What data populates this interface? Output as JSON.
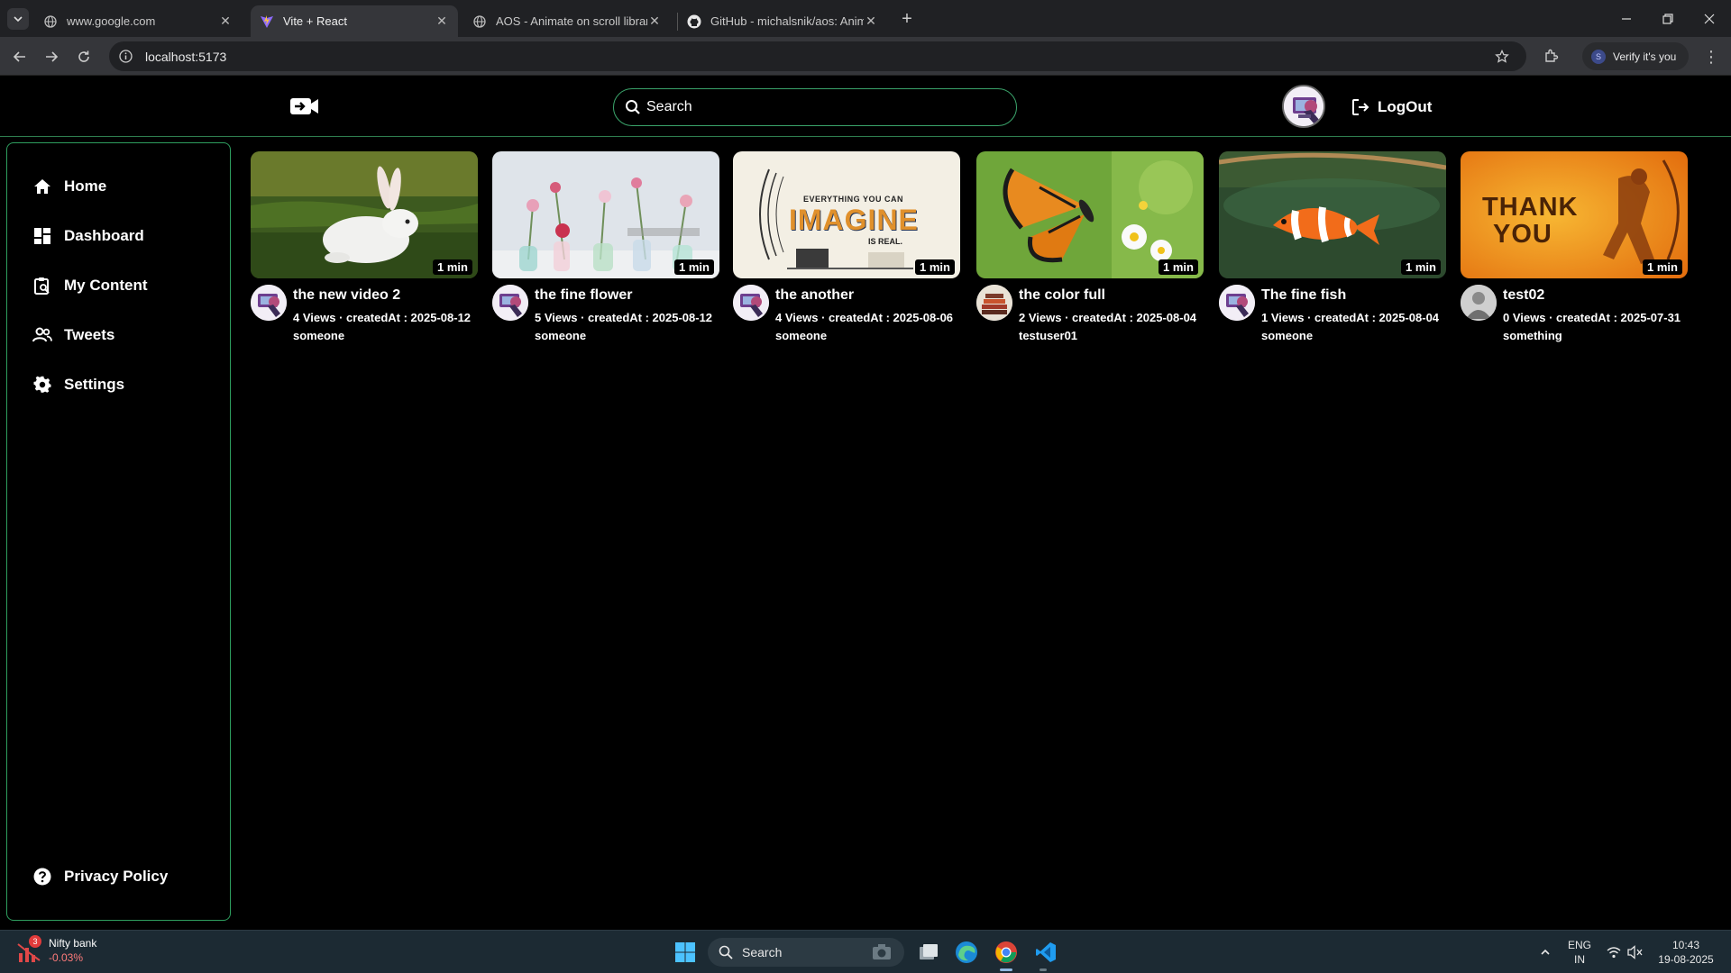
{
  "browser": {
    "tabs": [
      {
        "title": "www.google.com",
        "active": false
      },
      {
        "title": "Vite + React",
        "active": true
      },
      {
        "title": "AOS - Animate on scroll library",
        "active": false
      },
      {
        "title": "GitHub - michalsnik/aos: Anima",
        "active": false
      }
    ],
    "url": "localhost:5173",
    "profile_label": "Verify it's you",
    "profile_initial": "S"
  },
  "header": {
    "search_placeholder": "Search",
    "logout_label": "LogOut"
  },
  "sidebar": {
    "items": [
      {
        "label": "Home",
        "icon": "home-icon"
      },
      {
        "label": "Dashboard",
        "icon": "dashboard-icon"
      },
      {
        "label": "My Content",
        "icon": "content-icon"
      },
      {
        "label": "Tweets",
        "icon": "users-icon"
      },
      {
        "label": "Settings",
        "icon": "gear-icon"
      }
    ],
    "footer_item": {
      "label": "Privacy Policy",
      "icon": "help-icon"
    }
  },
  "videos": [
    {
      "title": "the new video 2",
      "stats": "4 Views · createdAt : 2025-08-12",
      "owner": "someone",
      "duration": "1 min"
    },
    {
      "title": "the fine flower",
      "stats": "5 Views · createdAt : 2025-08-12",
      "owner": "someone",
      "duration": "1 min"
    },
    {
      "title": "the another",
      "stats": "4 Views · createdAt : 2025-08-06",
      "owner": "someone",
      "duration": "1 min",
      "thumb_text_top": "EVERYTHING YOU CAN",
      "thumb_text_main": "IMAGINE",
      "thumb_text_bottom": "IS REAL."
    },
    {
      "title": "the color full",
      "stats": "2 Views · createdAt : 2025-08-04",
      "owner": "testuser01",
      "duration": "1 min"
    },
    {
      "title": "The fine fish",
      "stats": "1 Views · createdAt : 2025-08-04",
      "owner": "someone",
      "duration": "1 min"
    },
    {
      "title": "test02",
      "stats": "0 Views · createdAt : 2025-07-31",
      "owner": "something",
      "duration": "1 min",
      "thumb_text_line1": "THANK",
      "thumb_text_line2": "YOU"
    }
  ],
  "taskbar": {
    "stock_name": "Nifty bank",
    "stock_change": "-0.03%",
    "stock_badge": "3",
    "search_label": "Search",
    "lang_1": "ENG",
    "lang_2": "IN",
    "time": "10:43",
    "date": "19-08-2025"
  },
  "colors": {
    "accent_green": "#2e9e5f",
    "bg": "#000000"
  }
}
